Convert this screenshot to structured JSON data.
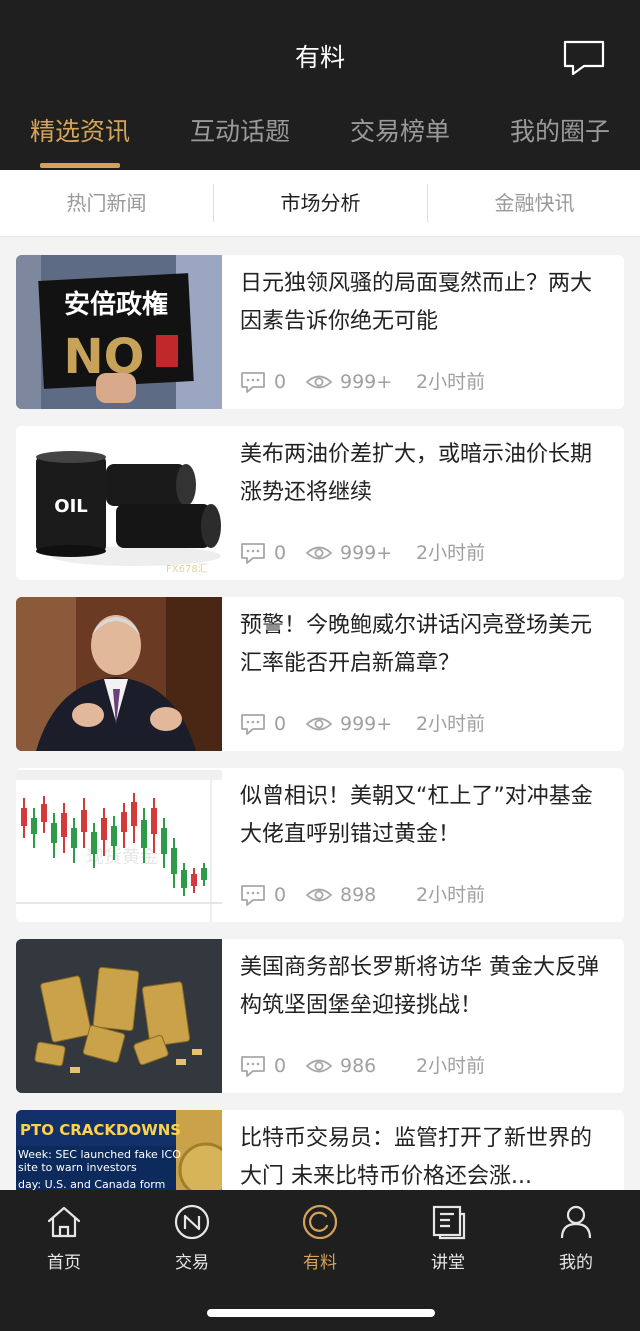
{
  "header": {
    "title": "有料",
    "main_tabs": [
      {
        "label": "精选资讯",
        "active": true
      },
      {
        "label": "互动话题",
        "active": false
      },
      {
        "label": "交易榜单",
        "active": false
      },
      {
        "label": "我的圈子",
        "active": false
      }
    ],
    "chat_icon": "chat-bubble-icon"
  },
  "sub_tabs": [
    {
      "label": "热门新闻",
      "active": false
    },
    {
      "label": "市场分析",
      "active": true
    },
    {
      "label": "金融快讯",
      "active": false
    }
  ],
  "articles": [
    {
      "title": "日元独领风骚的局面戛然而止？两大因素告诉你绝无可能",
      "comments": "0",
      "views": "999+",
      "time": "2小时前",
      "thumb_sign_text": "安倍政権",
      "thumb_sign_text2": "NO"
    },
    {
      "title": "美布两油价差扩大，或暗示油价长期涨势还将继续",
      "comments": "0",
      "views": "999+",
      "time": "2小时前",
      "thumb_barrel_text": "OIL",
      "thumb_watermark": "FX678汇"
    },
    {
      "title": "预警！今晚鲍威尔讲话闪亮登场美元汇率能否开启新篇章？",
      "comments": "0",
      "views": "999+",
      "time": "2小时前"
    },
    {
      "title": "似曾相识！美朝又“杠上了”对冲基金大佬直呼别错过黄金！",
      "comments": "0",
      "views": "898",
      "time": "2小时前",
      "thumb_chart_text": "现货黄金"
    },
    {
      "title": "美国商务部长罗斯将访华 黄金大反弹构筑坚固堡垒迎接挑战！",
      "comments": "0",
      "views": "986",
      "time": "2小时前"
    },
    {
      "title": "比特币交易员：监管打开了新世界的大门 未来比特币价格还会涨...",
      "thumb_headline": "PTO CRACKDOWNS",
      "thumb_line1": "Week: SEC launched fake ICO",
      "thumb_line2": "site to warn investors",
      "thumb_line3": "day: U.S. and Canada form"
    }
  ],
  "tabbar": [
    {
      "label": "首页",
      "icon": "home-icon",
      "active": false
    },
    {
      "label": "交易",
      "icon": "trade-icon",
      "active": false
    },
    {
      "label": "有料",
      "icon": "discover-icon",
      "active": true
    },
    {
      "label": "讲堂",
      "icon": "lecture-icon",
      "active": false
    },
    {
      "label": "我的",
      "icon": "profile-icon",
      "active": false
    }
  ],
  "colors": {
    "accent": "#d4a35a",
    "header_bg": "#1f1f1f",
    "meta_text": "#a0a0a0"
  }
}
